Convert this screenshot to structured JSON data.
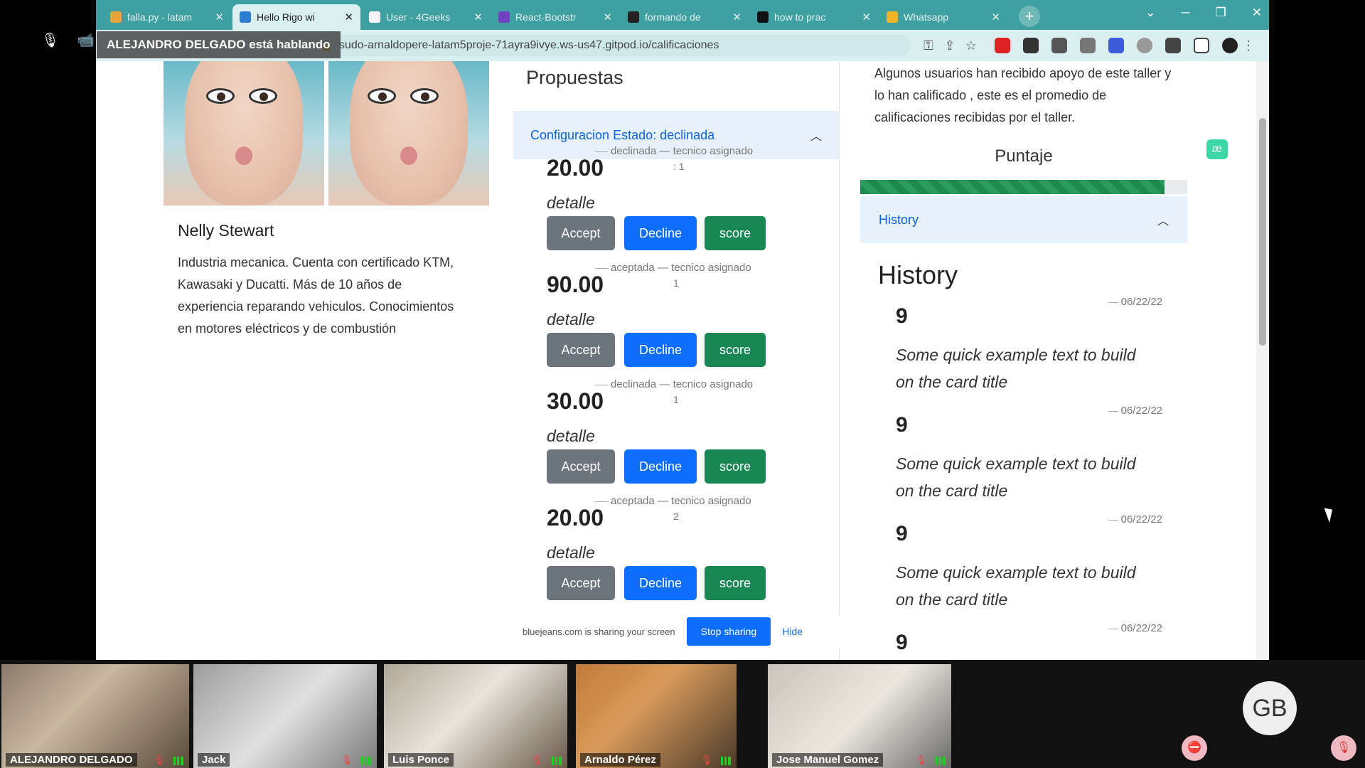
{
  "meeting": {
    "speaking_banner": "ALEJANDRO DELGADO está hablando"
  },
  "browser": {
    "tabs": [
      {
        "label": "falla.py - latam",
        "color": "#e8a33a",
        "active": false
      },
      {
        "label": "Hello Rigo wi",
        "color": "#2b7cd3",
        "active": true
      },
      {
        "label": "User - 4Geeks",
        "color": "#f4f4f4",
        "active": false
      },
      {
        "label": "React-Bootstr",
        "color": "#6f42c1",
        "active": false
      },
      {
        "label": "formando de",
        "color": "#222222",
        "active": false
      },
      {
        "label": "how to prac",
        "color": "#111111",
        "active": false
      },
      {
        "label": "Whatsapp",
        "color": "#f0b429",
        "active": false
      }
    ],
    "url": "sudo-arnaldopere-latam5proje-71ayra9ivye.ws-us47.gitpod.io/calificaciones"
  },
  "profile": {
    "name": "Nelly Stewart",
    "description": "Industria mecanica. Cuenta con certificado KTM, Kawasaki y Ducatti. Más de 10 años de experiencia reparando vehiculos. Conocimientos en motores eléctricos y de combustión"
  },
  "proposals": {
    "title": "Propuestas",
    "accordion_label": "Configuracion Estado: declinada",
    "items": [
      {
        "amount": "20.00",
        "state": "declinada",
        "tech_label": "tecnico asignado",
        "tech_value": ": 1",
        "detail": "detalle"
      },
      {
        "amount": "90.00",
        "state": "aceptada",
        "tech_label": "tecnico asignado",
        "tech_value": "1",
        "detail": "detalle"
      },
      {
        "amount": "30.00",
        "state": "declinada",
        "tech_label": "tecnico asignado",
        "tech_value": "1",
        "detail": "detalle"
      },
      {
        "amount": "20.00",
        "state": "aceptada",
        "tech_label": "tecnico asignado",
        "tech_value": "2",
        "detail": "detalle"
      }
    ],
    "buttons": {
      "accept": "Accept",
      "decline": "Decline",
      "score": "score"
    }
  },
  "share_bar": {
    "text": "bluejeans.com is sharing your screen",
    "stop": "Stop sharing",
    "hide": "Hide"
  },
  "ratings": {
    "intro": "Algunos usuarios han recibido apoyo de este taller y lo han calificado , este es el promedio de calificaciones recibidas por el taller.",
    "puntaje_label": "Puntaje",
    "puntaje_fraction": 0.93,
    "history_accordion": "History",
    "history_title": "History",
    "history": [
      {
        "date": "06/22/22",
        "score": "9",
        "text": "Some quick example text to build on the card title"
      },
      {
        "date": "06/22/22",
        "score": "9",
        "text": "Some quick example text to build on the card title"
      },
      {
        "date": "06/22/22",
        "score": "9",
        "text": "Some quick example text to build on the card title"
      },
      {
        "date": "06/22/22",
        "score": "9",
        "text": ""
      }
    ]
  },
  "participants": [
    {
      "name": "ALEJANDRO DELGADO",
      "speaking": true
    },
    {
      "name": "Jack",
      "speaking": false
    },
    {
      "name": "Luis Ponce",
      "speaking": false
    },
    {
      "name": "Arnaldo Pérez",
      "speaking": false
    },
    {
      "name": "Jose Manuel Gomez",
      "speaking": false
    }
  ],
  "avatar_initials": "GB"
}
